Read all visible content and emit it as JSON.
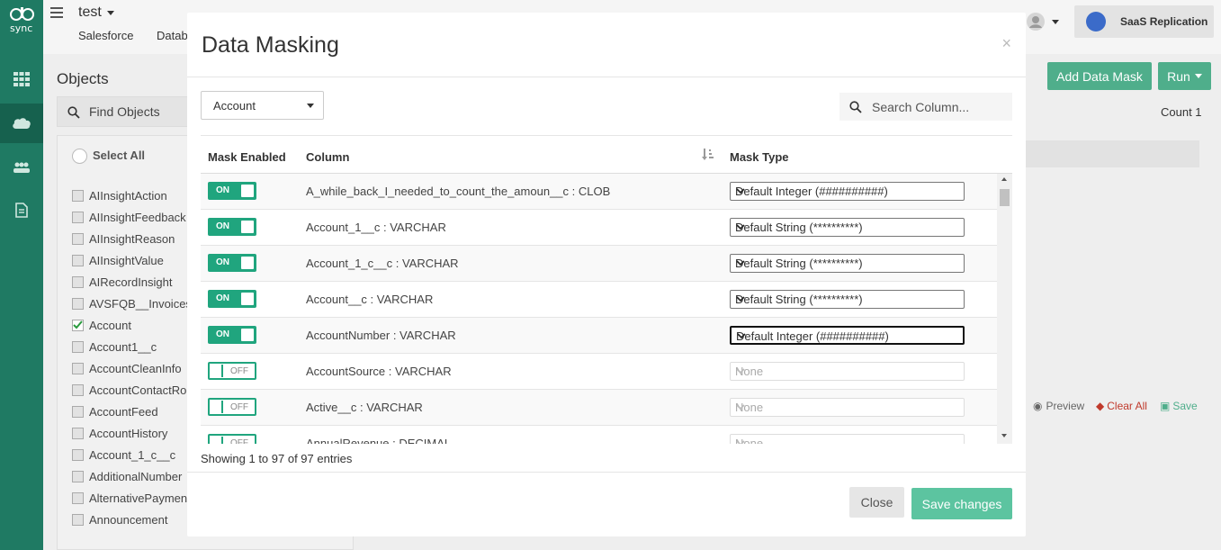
{
  "app": {
    "workspace": "test",
    "nav_tabs": [
      "Salesforce",
      "Datab"
    ]
  },
  "header_right": {
    "replication_label": "SaaS Replication"
  },
  "background": {
    "objects_title": "Objects",
    "find_placeholder": "Find Objects",
    "select_all": "Select All",
    "add_data_mask": "Add Data Mask",
    "run": "Run",
    "count": "Count 1",
    "preview": "Preview",
    "clear_all": "Clear All",
    "save": "Save",
    "objects": [
      {
        "name": "AIInsightAction",
        "checked": false
      },
      {
        "name": "AIInsightFeedback",
        "checked": false
      },
      {
        "name": "AIInsightReason",
        "checked": false
      },
      {
        "name": "AIInsightValue",
        "checked": false
      },
      {
        "name": "AIRecordInsight",
        "checked": false
      },
      {
        "name": "AVSFQB__Invoices",
        "checked": false
      },
      {
        "name": "Account",
        "checked": true
      },
      {
        "name": "Account1__c",
        "checked": false
      },
      {
        "name": "AccountCleanInfo",
        "checked": false
      },
      {
        "name": "AccountContactRol",
        "checked": false
      },
      {
        "name": "AccountFeed",
        "checked": false
      },
      {
        "name": "AccountHistory",
        "checked": false
      },
      {
        "name": "Account_1_c__c",
        "checked": false
      },
      {
        "name": "AdditionalNumber",
        "checked": false
      },
      {
        "name": "AlternativePayment",
        "checked": false
      },
      {
        "name": "Announcement",
        "checked": false
      }
    ]
  },
  "modal": {
    "title": "Data Masking",
    "close_glyph": "×",
    "object_select": "Account",
    "search_placeholder": "Search Column...",
    "columns": {
      "mask_enabled": "Mask Enabled",
      "column": "Column",
      "mask_type": "Mask Type"
    },
    "toggle_on": "ON",
    "toggle_off": "OFF",
    "rows": [
      {
        "enabled": true,
        "column": "A_while_back_I_needed_to_count_the_amoun__c : CLOB",
        "mask_type": "Default Integer (##########)",
        "focused": false
      },
      {
        "enabled": true,
        "column": "Account_1__c : VARCHAR",
        "mask_type": "Default String (**********)",
        "focused": false
      },
      {
        "enabled": true,
        "column": "Account_1_c__c : VARCHAR",
        "mask_type": "Default String (**********)",
        "focused": false
      },
      {
        "enabled": true,
        "column": "Account__c : VARCHAR",
        "mask_type": "Default String (**********)",
        "focused": false
      },
      {
        "enabled": true,
        "column": "AccountNumber : VARCHAR",
        "mask_type": "Default Integer (##########)",
        "focused": true
      },
      {
        "enabled": false,
        "column": "AccountSource : VARCHAR",
        "mask_type": "None",
        "focused": false
      },
      {
        "enabled": false,
        "column": "Active__c : VARCHAR",
        "mask_type": "None",
        "focused": false
      },
      {
        "enabled": false,
        "column": "AnnualRevenue : DECIMAL",
        "mask_type": "None",
        "focused": false
      }
    ],
    "entries_info": "Showing 1 to 97 of 97 entries",
    "close_button": "Close",
    "save_button": "Save changes"
  },
  "colors": {
    "brand_green": "#1f7a63",
    "toggle_green": "#20a57e",
    "save_button": "#5cc4a0",
    "clear_all_red": "#c0392b"
  }
}
